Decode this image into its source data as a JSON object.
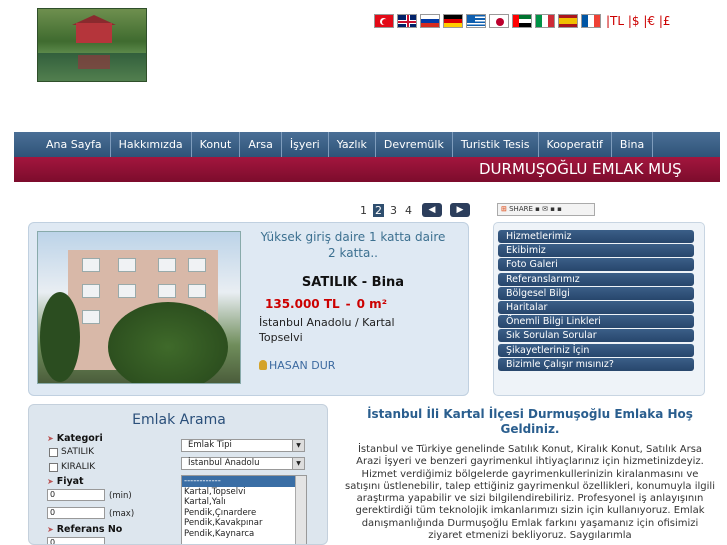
{
  "header": {
    "flags": [
      "Türkçe",
      "English",
      "Русский",
      "Deutsch",
      "Ελληνικά",
      "日本語",
      "العربية",
      "Italiano",
      "Español",
      "Français"
    ],
    "currencies": "|TL |$ |€ |£"
  },
  "nav": {
    "items": [
      "Ana Sayfa",
      "Hakkımızda",
      "Konut",
      "Arsa",
      "İşyeri",
      "Yazlık",
      "Devremülk",
      "Turistik Tesis",
      "Kooperatif",
      "Bina"
    ]
  },
  "marquee": {
    "text": "DURMUŞOĞLU EMLAK MUŞ"
  },
  "pager": {
    "pages": [
      "1",
      "2",
      "3",
      "4"
    ],
    "active": "2"
  },
  "share": {
    "label": "SHARE"
  },
  "listing": {
    "title": "Yüksek giriş daire 1 katta daire 2 katta..",
    "type": "SATILIK - Bina",
    "price": "135.000 TL",
    "separator": "-",
    "area": "0 m²",
    "location": "İstanbul Anadolu / Kartal Topselvi",
    "agent": "HASAN DUR"
  },
  "right_menu": {
    "items": [
      "Hizmetlerimiz",
      "Ekibimiz",
      "Foto Galeri",
      "Referanslarımız",
      "Bölgesel Bilgi",
      "Haritalar",
      "Önemli Bilgi Linkleri",
      "Sık Sorulan Sorular",
      "Şikayetleriniz İçin",
      "Bizimle Çalışır mısınız?"
    ]
  },
  "search": {
    "title": "Emlak Arama",
    "kategori_label": "Kategori",
    "satilik_label": "SATILIK",
    "kiralik_label": "KIRALIK",
    "fiyat_label": "Fiyat",
    "min_value": "0",
    "min_label": "(min)",
    "max_value": "0",
    "max_label": "(max)",
    "referans_label": "Referans No",
    "referans_value": "0",
    "emlak_tipi": "Emlak Tipi",
    "region": "İstanbul Anadolu",
    "districts": [
      "------------",
      "Kartal,Topselvi",
      "Kartal,Yalı",
      "Pendik,Çınardere",
      "Pendik,Kavakpınar",
      "Pendik,Kaynarca"
    ]
  },
  "intro": {
    "title": "İstanbul İli Kartal İlçesi Durmuşoğlu Emlaka Hoş Geldiniz.",
    "body": "İstanbul ve Türkiye genelinde Satılık Konut, Kiralık Konut, Satılık Arsa Arazi  İşyeri ve benzeri gayrimenkul ihtiyaçlarınız için hizmetinizdeyiz. Hizmet verdiğimiz bölgelerde gayrimenkullerinizin kiralanmasını ve satışını üstlenebilir, talep ettiğiniz gayrimenkul özellikleri, konumuyla ilgili araştırma yapabilir ve sizi bilgilendirebiliriz. Profesyonel iş anlayışının gerektirdiği tüm teknolojik imkanlarımızı sizin için kullanıyoruz. Emlak danışmanlığında Durmuşoğlu Emlak farkını yaşamanız için ofisimizi ziyaret etmenizi bekliyoruz. Saygılarımla"
  },
  "colors": {
    "nav": "#2f5378",
    "marquee": "#8c1034",
    "price": "#cc0000",
    "accent": "#2a5e8e"
  }
}
